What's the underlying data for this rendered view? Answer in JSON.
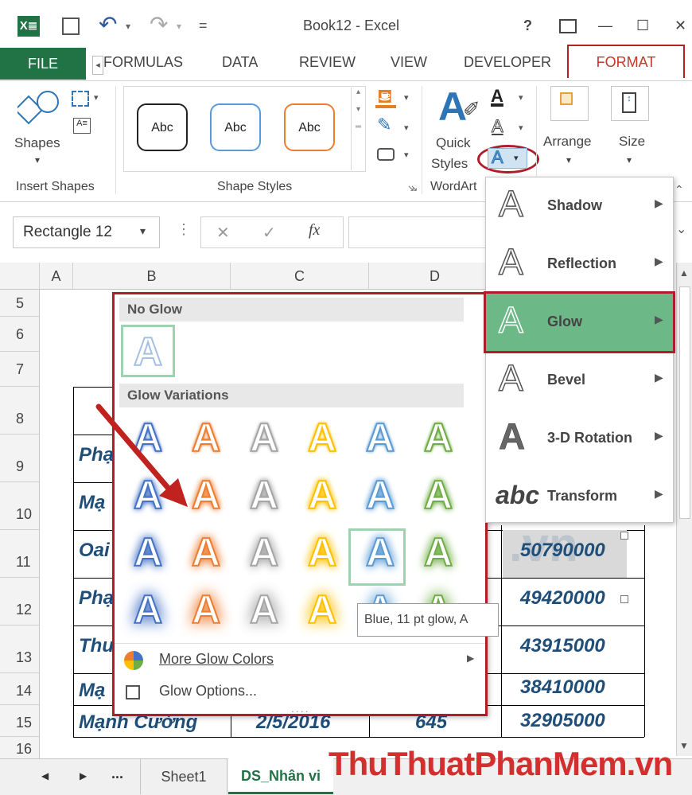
{
  "title_bar": {
    "title": "Book12 - Excel",
    "help": "?",
    "minimize": "—",
    "maximize": "☐",
    "close": "✕",
    "quick_access": "="
  },
  "tabs": {
    "file": "FILE",
    "formulas": "FORMULAS",
    "data": "DATA",
    "review": "REVIEW",
    "view": "VIEW",
    "developer": "DEVELOPER",
    "format": "FORMAT"
  },
  "ribbon": {
    "shapes_label": "Shapes",
    "insert_shapes_group": "Insert Shapes",
    "shape_styles_group": "Shape Styles",
    "wordart_group": "WordArt",
    "abc": [
      "Abc",
      "Abc",
      "Abc"
    ],
    "quick_styles": [
      "Quick",
      "Styles"
    ],
    "arrange": "Arrange",
    "size": "Size"
  },
  "formula_bar": {
    "name_box": "Rectangle 12",
    "fx": "fx"
  },
  "grid": {
    "columns": [
      "A",
      "B",
      "C",
      "D"
    ],
    "rows": [
      "5",
      "6",
      "7",
      "8",
      "9",
      "10",
      "11",
      "12",
      "13",
      "14",
      "15",
      "16"
    ],
    "names": [
      "Phạ",
      "Mạ",
      "Oai",
      "Phạ",
      "Thu",
      "Mạ",
      "Mạnh Cường"
    ],
    "c15": "2/5/2016",
    "d15": "645",
    "e_values": [
      "50790000",
      "49420000",
      "43915000",
      "38410000",
      "32905000"
    ],
    "wm": ".vn"
  },
  "glow_panel": {
    "no_glow": "No Glow",
    "variations": "Glow Variations",
    "tooltip": "Blue, 11 pt glow, A",
    "more_colors": "More Glow Colors",
    "options": "Glow Options...",
    "letter": "A",
    "glow_colors": [
      "#4472c4",
      "#ed7d31",
      "#a5a5a5",
      "#ffc000",
      "#5b9bd5",
      "#70ad47"
    ]
  },
  "submenu": {
    "items": [
      {
        "label": "Shadow",
        "icon": "A"
      },
      {
        "label": "Reflection",
        "icon": "A"
      },
      {
        "label": "Glow",
        "icon": "A"
      },
      {
        "label": "Bevel",
        "icon": "A"
      },
      {
        "label": "3-D Rotation",
        "icon": "A"
      },
      {
        "label": "Transform",
        "icon": "abc"
      }
    ]
  },
  "sheet_tabs": {
    "more": "...",
    "sheet1": "Sheet1",
    "active": "DS_Nhân vi"
  },
  "watermark": "ThuThuatPhanMem.vn"
}
